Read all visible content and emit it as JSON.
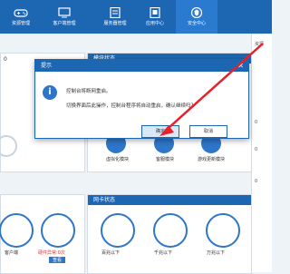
{
  "nav": {
    "items": [
      {
        "label": "资源管理",
        "icon": "gamepad-icon"
      },
      {
        "label": "客户端管理",
        "icon": "monitor-icon"
      },
      {
        "label": "服务器管理",
        "icon": "server-icon"
      },
      {
        "label": "应用中心",
        "icon": "apps-icon"
      },
      {
        "label": "安全中心",
        "icon": "shield-icon"
      }
    ],
    "active_index": 4
  },
  "left_panel": {
    "title": "",
    "top_left": "0"
  },
  "status_panel": {
    "title": "模块状态"
  },
  "modules": [
    {
      "label": "虚拟化模块"
    },
    {
      "label": "客服模块"
    },
    {
      "label": "游戏更新模块"
    }
  ],
  "right_strip": {
    "title": "资源",
    "items": [
      "0",
      "0",
      "0"
    ]
  },
  "net_panel": {
    "title": "网卡状态"
  },
  "net_items": [
    {
      "label": "百兆以下"
    },
    {
      "label": "千兆以下"
    },
    {
      "label": "万兆以下"
    }
  ],
  "bottom_left": [
    {
      "label": "客户端"
    },
    {
      "label": "硬件异常:0次",
      "badge": "查看"
    }
  ],
  "dialog": {
    "title": "提示",
    "line1": "控制台将断网重启。",
    "line2": "切换界面后此操作，控制台程序将自动重启，确认继续吗？",
    "ok": "确定",
    "cancel": "取消"
  },
  "colors": {
    "primary": "#1d66b2",
    "arrow": "#e8202a"
  }
}
